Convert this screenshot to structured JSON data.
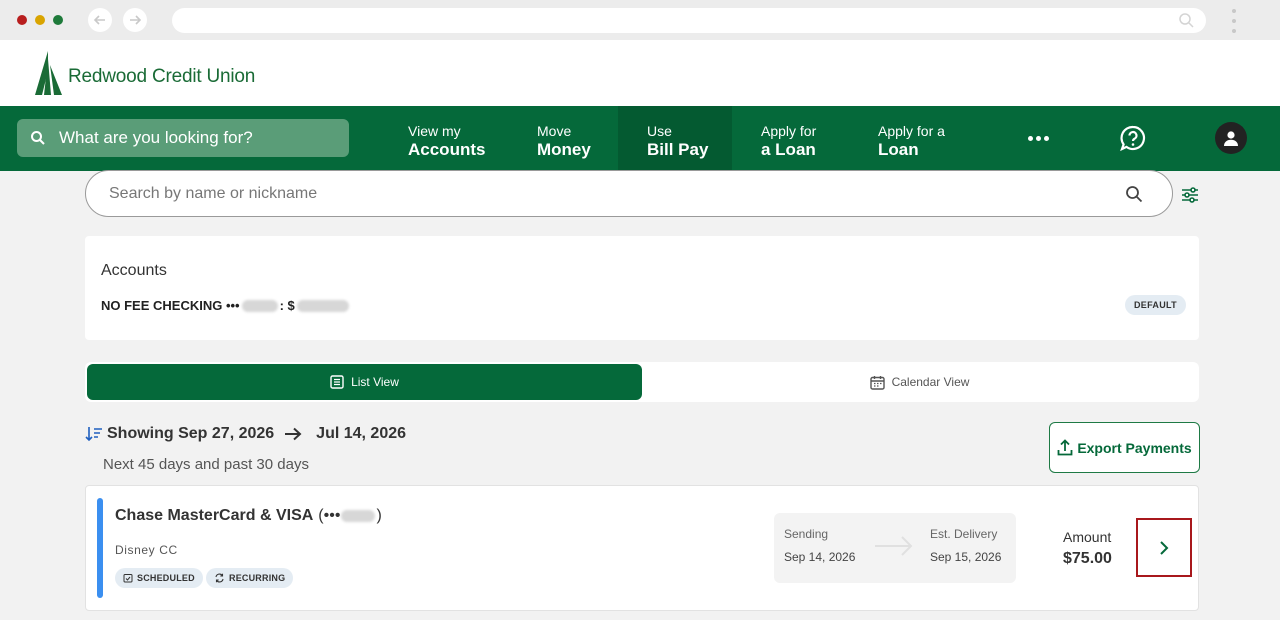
{
  "browser": {
    "back_icon": "arrow-left-icon",
    "forward_icon": "arrow-right-icon",
    "menu_icon": "kebab-icon"
  },
  "brand": {
    "name": "Redwood Credit Union",
    "color": "#05693a"
  },
  "nav": {
    "search_placeholder": "What are you looking for?",
    "items": [
      {
        "line1": "View my",
        "line2": "Accounts"
      },
      {
        "line1": "Move",
        "line2": "Money"
      },
      {
        "line1": "Use",
        "line2": "Bill Pay",
        "active": true
      },
      {
        "line1": "Apply for",
        "line2": "a Loan"
      },
      {
        "line1": "Apply for a",
        "line2": "Loan"
      }
    ]
  },
  "payee_search": {
    "placeholder": "Search by name or nickname"
  },
  "accounts": {
    "title": "Accounts",
    "account_name": "NO FEE CHECKING •••",
    "separator": ": $",
    "default_badge": "DEFAULT"
  },
  "view_toggle": {
    "list_label": "List View",
    "calendar_label": "Calendar View",
    "selected": "List View"
  },
  "range": {
    "start": "Showing Sep 27, 2026",
    "end": "Jul 14, 2026",
    "subtitle": "Next 45 days and past 30 days"
  },
  "export_label": "Export Payments",
  "payment": {
    "payee": "Chase MasterCard & VISA",
    "suffix_open": "(•••",
    "suffix_close": ")",
    "nickname": "Disney CC",
    "tags": [
      "SCHEDULED",
      "RECURRING"
    ],
    "sending_label": "Sending",
    "sending_date": "Sep 14, 2026",
    "delivery_label": "Est. Delivery",
    "delivery_date": "Sep 15, 2026",
    "amount_label": "Amount",
    "amount": "$75.00",
    "status_color": "#3b8ff0"
  }
}
